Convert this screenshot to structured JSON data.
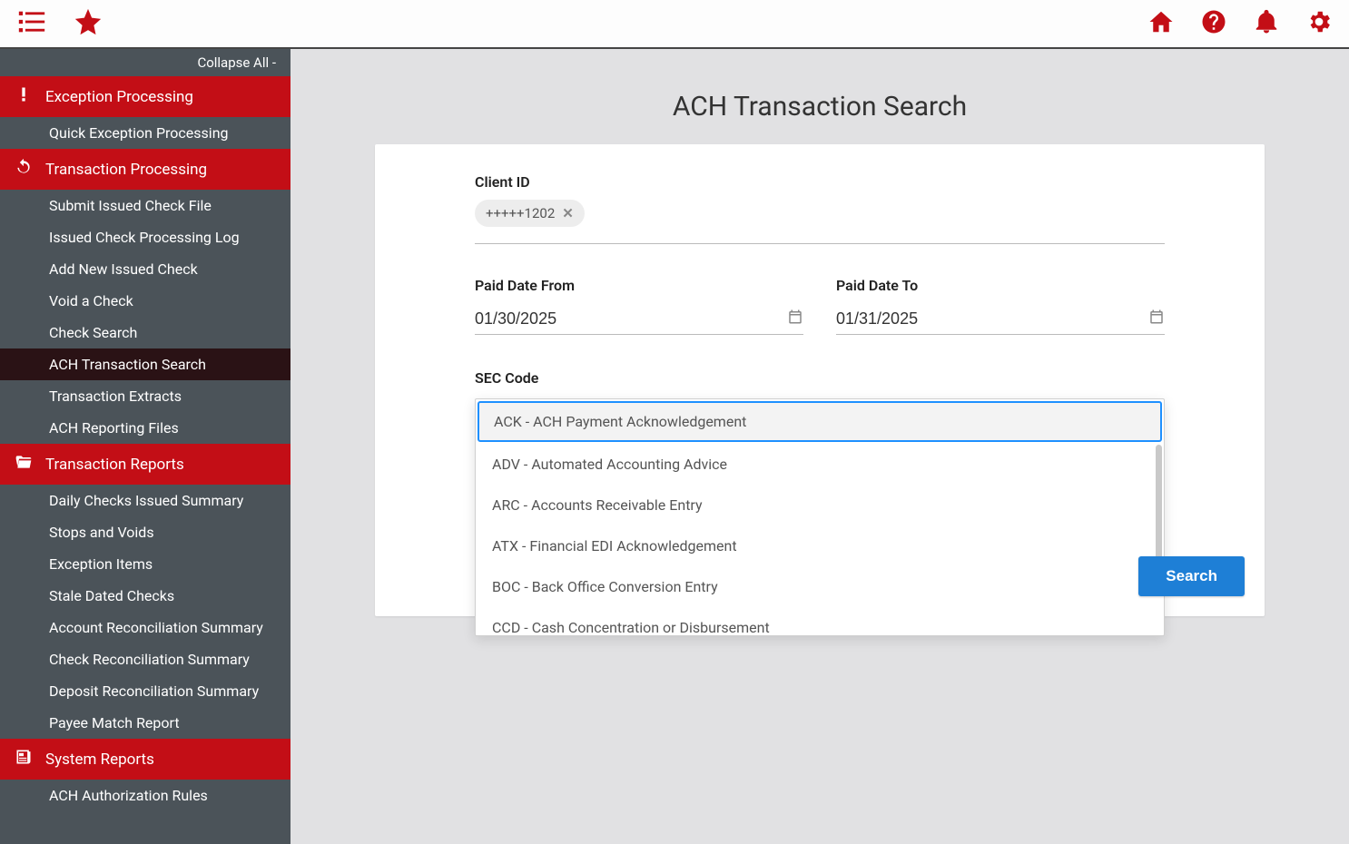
{
  "topbar": {
    "left_icons": [
      "menu-list-icon",
      "star-icon"
    ],
    "right_icons": [
      "home-icon",
      "help-icon",
      "bell-icon",
      "gear-icon"
    ]
  },
  "sidebar": {
    "collapse_label": "Collapse All -",
    "sections": [
      {
        "icon": "exclamation-icon",
        "label": "Exception Processing",
        "items": [
          {
            "label": "Quick Exception Processing",
            "active": false
          }
        ]
      },
      {
        "icon": "refresh-icon",
        "label": "Transaction Processing",
        "items": [
          {
            "label": "Submit Issued Check File",
            "active": false
          },
          {
            "label": "Issued Check Processing Log",
            "active": false
          },
          {
            "label": "Add New Issued Check",
            "active": false
          },
          {
            "label": "Void a Check",
            "active": false
          },
          {
            "label": "Check Search",
            "active": false
          },
          {
            "label": "ACH Transaction Search",
            "active": true
          },
          {
            "label": "Transaction Extracts",
            "active": false
          },
          {
            "label": "ACH Reporting Files",
            "active": false
          }
        ]
      },
      {
        "icon": "folder-open-icon",
        "label": "Transaction Reports",
        "items": [
          {
            "label": "Daily Checks Issued Summary",
            "active": false
          },
          {
            "label": "Stops and Voids",
            "active": false
          },
          {
            "label": "Exception Items",
            "active": false
          },
          {
            "label": "Stale Dated Checks",
            "active": false
          },
          {
            "label": "Account Reconciliation Summary",
            "active": false
          },
          {
            "label": "Check Reconciliation Summary",
            "active": false
          },
          {
            "label": "Deposit Reconciliation Summary",
            "active": false
          },
          {
            "label": "Payee Match Report",
            "active": false
          }
        ]
      },
      {
        "icon": "newspaper-icon",
        "label": "System Reports",
        "items": [
          {
            "label": "ACH Authorization Rules",
            "active": false
          }
        ]
      }
    ]
  },
  "page": {
    "title": "ACH Transaction Search",
    "client_id_label": "Client ID",
    "client_id_chip": "+++++1202",
    "paid_from_label": "Paid Date From",
    "paid_from_value": "01/30/2025",
    "paid_to_label": "Paid Date To",
    "paid_to_value": "01/31/2025",
    "sec_label": "SEC Code",
    "search_button": "Search",
    "sec_options": [
      "ACK - ACH Payment Acknowledgement",
      "ADV - Automated Accounting Advice",
      "ARC - Accounts Receivable Entry",
      "ATX - Financial EDI Acknowledgement",
      "BOC - Back Office Conversion Entry",
      "CCD - Cash Concentration or Disbursement"
    ]
  }
}
